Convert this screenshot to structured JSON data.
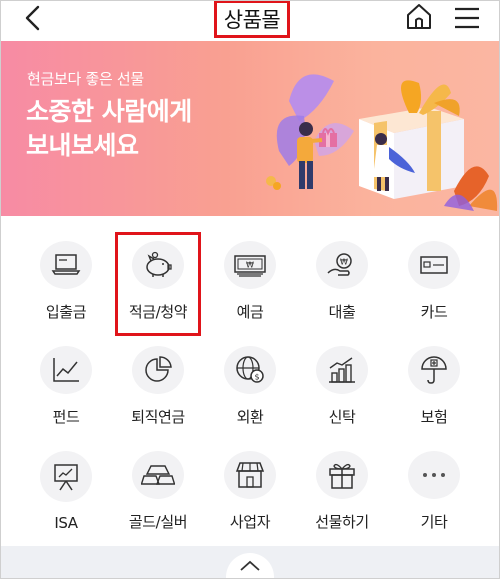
{
  "header": {
    "title": "상품몰",
    "back_icon": "back-arrow-icon",
    "home_icon": "home-icon",
    "menu_icon": "hamburger-menu-icon"
  },
  "banner": {
    "subtitle": "현금보다 좋은 선물",
    "title_line1": "소중한 사람에게",
    "title_line2": "보내보세요"
  },
  "categories": [
    {
      "label": "입출금",
      "icon": "laptop-icon"
    },
    {
      "label": "적금/청약",
      "icon": "piggy-bank-icon"
    },
    {
      "label": "예금",
      "icon": "banknote-icon"
    },
    {
      "label": "대출",
      "icon": "hand-coin-icon"
    },
    {
      "label": "카드",
      "icon": "card-icon"
    },
    {
      "label": "펀드",
      "icon": "line-chart-icon"
    },
    {
      "label": "퇴직연금",
      "icon": "pie-chart-icon"
    },
    {
      "label": "외환",
      "icon": "globe-dollar-icon"
    },
    {
      "label": "신탁",
      "icon": "bar-chart-icon"
    },
    {
      "label": "보험",
      "icon": "umbrella-icon"
    },
    {
      "label": "ISA",
      "icon": "presentation-board-icon"
    },
    {
      "label": "골드/실버",
      "icon": "gold-bar-icon"
    },
    {
      "label": "사업자",
      "icon": "shop-icon"
    },
    {
      "label": "선물하기",
      "icon": "gift-icon"
    },
    {
      "label": "기타",
      "icon": "more-dots-icon"
    }
  ],
  "colors": {
    "highlight": "#e0141a",
    "banner_start": "#f78ba4",
    "banner_end": "#fbb6a2",
    "icon_circle": "#f2f2f4"
  },
  "highlighted_item": "적금/청약"
}
